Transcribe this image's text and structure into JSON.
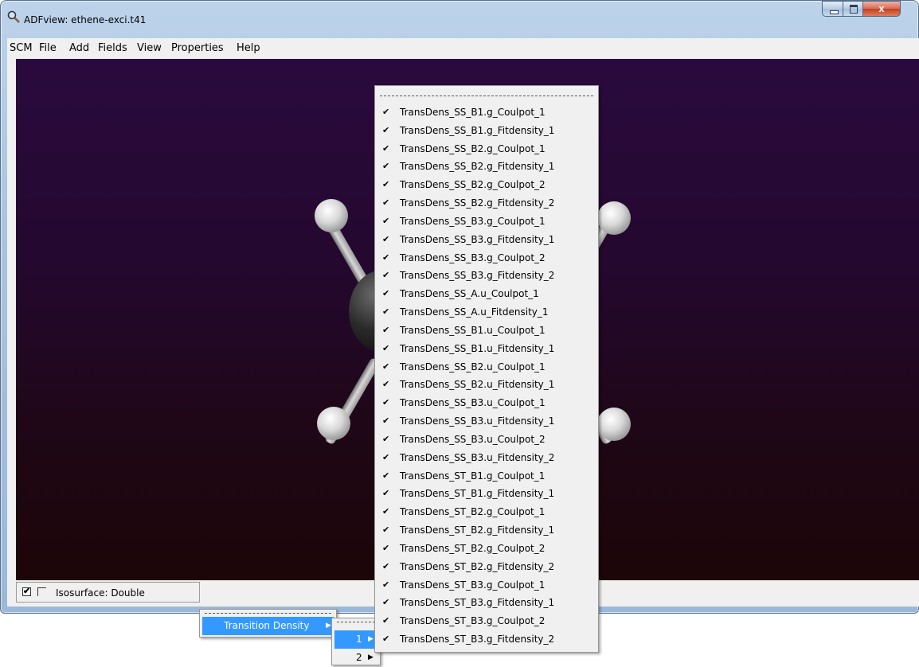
{
  "window": {
    "title": "ADFview: ethene-exci.t41",
    "close_glyph": "x"
  },
  "menubar": [
    "SCM",
    "File",
    "Add",
    "Fields",
    "View",
    "Properties",
    "Help"
  ],
  "status": {
    "checkbox1": "✔",
    "label": "Isosurface: Double"
  },
  "menus": {
    "level1": {
      "label": "Transition Density",
      "arrow": "▶"
    },
    "level2": [
      {
        "label": "1",
        "arrow": "▶"
      },
      {
        "label": "2",
        "arrow": "▶"
      }
    ],
    "check_glyph": "✔",
    "fields": [
      "TransDens_SS_B1.g_Coulpot_1",
      "TransDens_SS_B1.g_Fitdensity_1",
      "TransDens_SS_B2.g_Coulpot_1",
      "TransDens_SS_B2.g_Fitdensity_1",
      "TransDens_SS_B2.g_Coulpot_2",
      "TransDens_SS_B2.g_Fitdensity_2",
      "TransDens_SS_B3.g_Coulpot_1",
      "TransDens_SS_B3.g_Fitdensity_1",
      "TransDens_SS_B3.g_Coulpot_2",
      "TransDens_SS_B3.g_Fitdensity_2",
      "TransDens_SS_A.u_Coulpot_1",
      "TransDens_SS_A.u_Fitdensity_1",
      "TransDens_SS_B1.u_Coulpot_1",
      "TransDens_SS_B1.u_Fitdensity_1",
      "TransDens_SS_B2.u_Coulpot_1",
      "TransDens_SS_B2.u_Fitdensity_1",
      "TransDens_SS_B3.u_Coulpot_1",
      "TransDens_SS_B3.u_Fitdensity_1",
      "TransDens_SS_B3.u_Coulpot_2",
      "TransDens_SS_B3.u_Fitdensity_2",
      "TransDens_ST_B1.g_Coulpot_1",
      "TransDens_ST_B1.g_Fitdensity_1",
      "TransDens_ST_B2.g_Coulpot_1",
      "TransDens_ST_B2.g_Fitdensity_1",
      "TransDens_ST_B2.g_Coulpot_2",
      "TransDens_ST_B2.g_Fitdensity_2",
      "TransDens_ST_B3.g_Coulpot_1",
      "TransDens_ST_B3.g_Fitdensity_1",
      "TransDens_ST_B3.g_Coulpot_2",
      "TransDens_ST_B3.g_Fitdensity_2"
    ]
  },
  "colors": {
    "menu_highlight": "#3399ff",
    "viewport_top": "#2a0a3e",
    "viewport_bottom": "#1c0608"
  }
}
